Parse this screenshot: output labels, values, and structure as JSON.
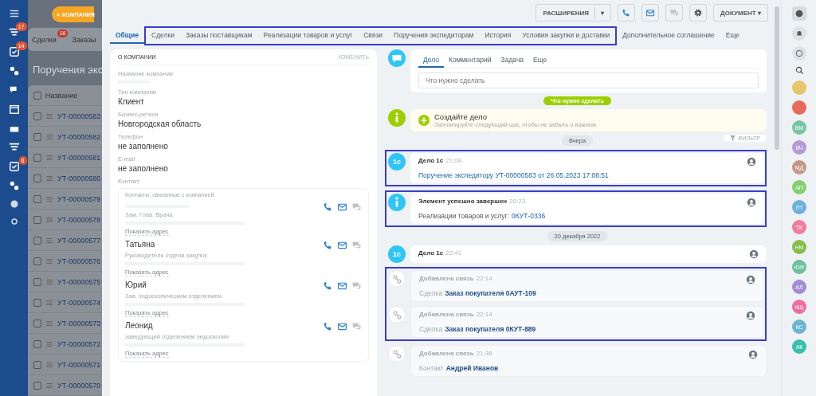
{
  "app_sidebar": {
    "badges": [
      "17",
      "14",
      "8"
    ]
  },
  "background_list": {
    "tabs": [
      {
        "label": "Сделки",
        "counter": "16"
      },
      {
        "label": "Заказы"
      }
    ],
    "title": "Поручения экс",
    "column": "Название",
    "all_checked": false,
    "rows": [
      {
        "id": "УТ-00000583",
        "checked": false
      },
      {
        "id": "УТ-00000582",
        "checked": false
      },
      {
        "id": "УТ-00000581",
        "checked": false
      },
      {
        "id": "УТ-00000580",
        "checked": false
      },
      {
        "id": "УТ-00000579",
        "checked": false
      },
      {
        "id": "УТ-00000578",
        "checked": false
      },
      {
        "id": "УТ-00000577",
        "checked": false
      },
      {
        "id": "УТ-00000576",
        "checked": false
      },
      {
        "id": "УТ-00000575",
        "checked": false
      },
      {
        "id": "УТ-00000574",
        "checked": false
      },
      {
        "id": "УТ-00000573",
        "checked": false
      },
      {
        "id": "УТ-00000572",
        "checked": false
      },
      {
        "id": "УТ-00000571",
        "checked": false
      },
      {
        "id": "УТ-00000570",
        "checked": false
      }
    ]
  },
  "entity_badge": {
    "close": "×",
    "label": "КОМПАНИЯ"
  },
  "toolbar": {
    "extensions": "РАСШИРЕНИЯ",
    "extensions_caret": "▾",
    "document": "ДОКУМЕНТ",
    "document_caret": "▾"
  },
  "tabs": [
    {
      "kind": "tab",
      "label": "Общие",
      "selected": true
    },
    {
      "kind": "highlight",
      "tabs": [
        {
          "label": "Сделки",
          "selected": false
        },
        {
          "label": "Заказы поставщикам",
          "selected": false
        },
        {
          "label": "Реализации товаров и услуг",
          "selected": false
        },
        {
          "label": "Связи",
          "selected": false
        },
        {
          "label": "Поручения экспедиторам",
          "selected": false
        },
        {
          "label": "История",
          "selected": false
        },
        {
          "label": "Условия закупки и доставки",
          "selected": false
        }
      ]
    },
    {
      "kind": "tab",
      "label": "Дополнительное соглашение",
      "selected": false
    },
    {
      "kind": "tab",
      "label": "Еще",
      "selected": false
    }
  ],
  "about": {
    "title": "О КОМПАНИИ",
    "edit": "ИЗМЕНИТЬ",
    "fields": [
      {
        "label": "Название компании"
      },
      {
        "label": "Тип компании",
        "value": "Клиент"
      },
      {
        "label": "Бизнес-регион",
        "value": "Новгородская область"
      },
      {
        "label": "Телефон",
        "value": "не заполнено"
      },
      {
        "label": "E-mail",
        "value": "не заполнено"
      }
    ],
    "contact_label": "Контакт",
    "contacts_header": "Контакты, связанные с компанией",
    "contacts": [
      {
        "position": "Зам. Глав. Врача",
        "address": "Показать адрес"
      },
      {
        "name": "Татьяна",
        "position": "Руководитель отдела закупок",
        "address": "Показать адрес"
      },
      {
        "name": "Юрий",
        "position": "Зав. эндоскопическим отделением",
        "address": "Показать адрес"
      },
      {
        "name": "Леонид",
        "position": "заведующий отделением эндоскопии",
        "address": "Показать адрес"
      }
    ]
  },
  "composer": {
    "tabs": [
      {
        "label": "Дело",
        "selected": true
      },
      {
        "label": "Комментарий",
        "selected": false
      },
      {
        "label": "Задача",
        "selected": false
      },
      {
        "label": "Еще",
        "selected": false
      }
    ],
    "placeholder": "Что нужно сделать"
  },
  "timeline": [
    {
      "kind": "pill",
      "text": "Что нужно сделать"
    },
    {
      "kind": "hint",
      "title": "Создайте дело",
      "text": "Запланируйте следующий шаг, чтобы не забыть о важном"
    },
    {
      "kind": "divider",
      "text": "Вчера",
      "filter": "ФИЛЬТР"
    },
    {
      "kind": "highlight",
      "items": [
        {
          "kind": "activity",
          "badge": "1с",
          "title": "Дело 1с",
          "time": "21:08",
          "link": "Поручение экспедитору УТ-00000583 от 26.05.2023 17:08:51"
        }
      ]
    },
    {
      "kind": "highlight",
      "items": [
        {
          "kind": "info",
          "title": "Элемент успешно завершен",
          "time": "20:23",
          "prefix": "Реализации товаров и услуг:",
          "link": "0КУТ-0336"
        }
      ]
    },
    {
      "kind": "divider",
      "text": "20 декабря 2022"
    },
    {
      "kind": "activity",
      "badge": "1с",
      "title": "Дело 1с",
      "time": "22:41"
    },
    {
      "kind": "highlight",
      "items": [
        {
          "kind": "link",
          "title": "Добавлена связь",
          "time": "22:14",
          "prefix": "Сделка",
          "link": "Заказ покупателя 0АУТ-109"
        },
        {
          "kind": "link",
          "title": "Добавлена связь",
          "time": "22:14",
          "prefix": "Сделка",
          "link": "Заказ покупателя 0КУТ-889"
        }
      ]
    },
    {
      "kind": "link",
      "title": "Добавлена связь",
      "time": "21:38",
      "prefix": "Контакт",
      "link": "Андрей Иванов"
    }
  ],
  "right_sidebar": {
    "avatars": [
      {
        "color": "#e8c46a"
      },
      {
        "color": "#e86a5a"
      },
      {
        "initials": "ВМ",
        "color": "#78c4a4"
      },
      {
        "initials": "ВЧ",
        "color": "#b49ad8"
      },
      {
        "initials": "МД",
        "color": "#c49686"
      },
      {
        "initials": "АП",
        "color": "#84d070"
      },
      {
        "initials": "ЛТ",
        "color": "#6cb0e0"
      },
      {
        "initials": "ТК",
        "color": "#f07c9c"
      },
      {
        "initials": "НМ",
        "color": "#88bc48"
      },
      {
        "initials": "ЮФ",
        "color": "#6cc09c"
      },
      {
        "initials": "АЛ",
        "color": "#a48cd4"
      },
      {
        "initials": "КЩ",
        "color": "#f06c9c"
      },
      {
        "initials": "КС",
        "color": "#6cb4d4"
      },
      {
        "initials": "АК",
        "color": "#38c0ac"
      }
    ]
  }
}
